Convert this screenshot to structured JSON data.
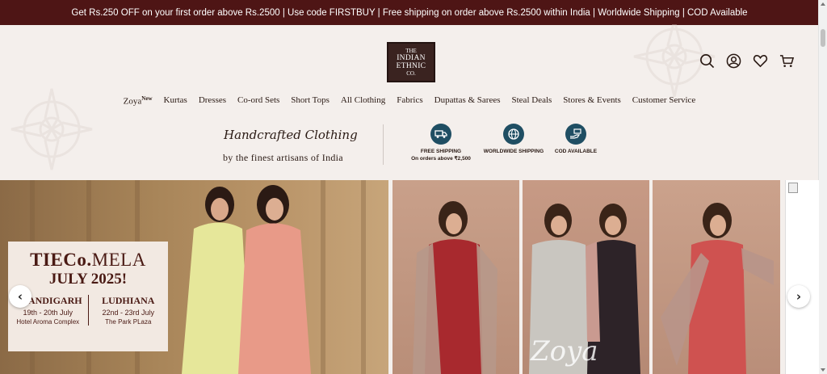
{
  "announcement": "Get Rs.250 OFF on your first order above Rs.2500 | Use code FIRSTBUY | Free shipping on order above Rs.2500 within India | Worldwide Shipping | COD Available",
  "logo": {
    "line1": "THE",
    "line2": "INDIAN",
    "line3": "ETHNIC",
    "line4": "CO."
  },
  "header_icons": [
    "search-icon",
    "account-icon",
    "wishlist-heart-icon",
    "cart-icon"
  ],
  "nav": {
    "items": [
      {
        "label": "Zoya",
        "badge": "New"
      },
      {
        "label": "Kurtas"
      },
      {
        "label": "Dresses"
      },
      {
        "label": "Co-ord Sets"
      },
      {
        "label": "Short Tops"
      },
      {
        "label": "All Clothing"
      },
      {
        "label": "Fabrics"
      },
      {
        "label": "Dupattas & Sarees"
      },
      {
        "label": "Steal Deals"
      },
      {
        "label": "Stores & Events"
      },
      {
        "label": "Customer Service"
      }
    ]
  },
  "promo": {
    "headline": "Handcrafted Clothing",
    "byline": "by the finest artisans of India",
    "features": [
      {
        "icon": "truck-icon",
        "line1": "FREE SHIPPING",
        "line2": "On orders above ₹2,500"
      },
      {
        "icon": "globe-icon",
        "line1": "WORLDWIDE SHIPPING",
        "line2": ""
      },
      {
        "icon": "cod-hand-icon",
        "line1": "COD AVAILABLE",
        "line2": ""
      }
    ]
  },
  "banner": {
    "title_bold": "TIECo.",
    "title_rest": "MELA",
    "subtitle": "JULY 2025!",
    "events": [
      {
        "city": "CHANDIGARH",
        "dates": "19th - 20th July",
        "venue": "Hotel Aroma Complex"
      },
      {
        "city": "LUDHIANA",
        "dates": "22nd - 23rd July",
        "venue": "The Park PLaza"
      }
    ],
    "watermark": "Zoya"
  },
  "colors": {
    "topbar": "#4e1515",
    "accent": "#1f4e63",
    "banner_text": "#4a1a14"
  }
}
